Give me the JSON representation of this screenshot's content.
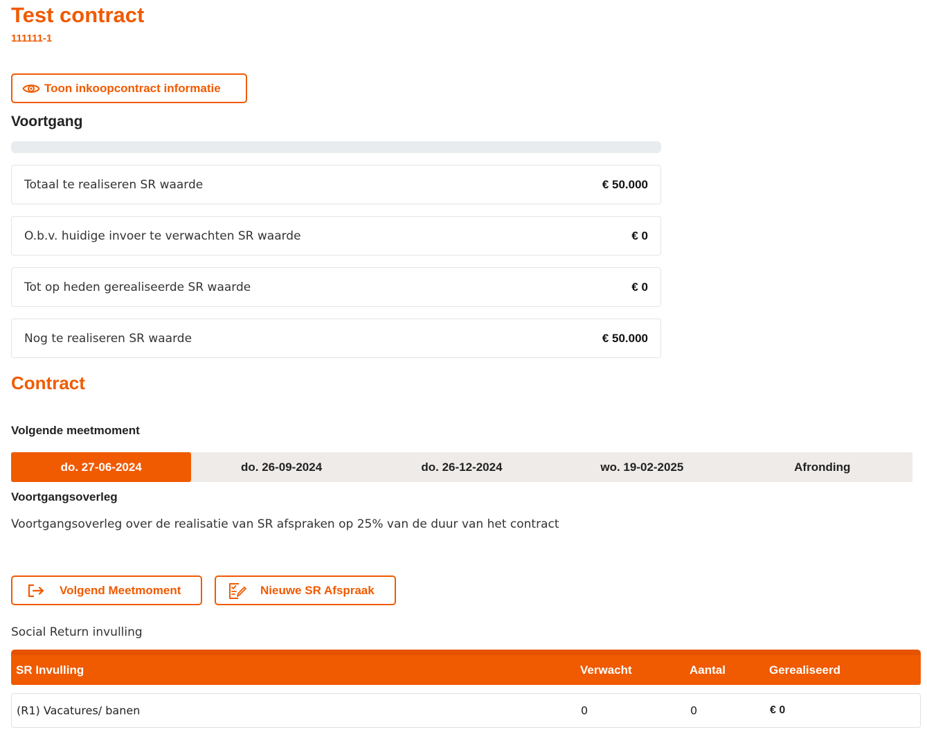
{
  "header": {
    "title": "Test contract",
    "contract_number": "111111-1"
  },
  "info_button": {
    "label": "Toon inkoopcontract informatie",
    "icon": "eye-icon"
  },
  "progress": {
    "heading": "Voortgang",
    "fraction": 0,
    "rows": [
      {
        "label": "Totaal te realiseren SR waarde",
        "value": "€ 50.000"
      },
      {
        "label": "O.b.v. huidige invoer te verwachten SR waarde",
        "value": "€ 0"
      },
      {
        "label": "Tot op heden gerealiseerde SR waarde",
        "value": "€ 0"
      },
      {
        "label": "Nog te realiseren SR waarde",
        "value": "€ 50.000"
      }
    ]
  },
  "contract": {
    "heading": "Contract",
    "next_moment_label": "Volgende meetmoment",
    "moments": [
      {
        "label": "do. 27-06-2024",
        "active": true
      },
      {
        "label": "do. 26-09-2024",
        "active": false
      },
      {
        "label": "do. 26-12-2024",
        "active": false
      },
      {
        "label": "wo. 19-02-2025",
        "active": false
      },
      {
        "label": "Afronding",
        "active": false
      }
    ],
    "moment_title": "Voortgangsoverleg",
    "moment_description": "Voortgangsoverleg over de realisatie van SR afspraken op 25% van de duur van het contract"
  },
  "actions": {
    "next_moment": {
      "label": "Volgend Meetmoment",
      "icon": "exit-arrow-icon"
    },
    "new_agreement": {
      "label": "Nieuwe SR Afspraak",
      "icon": "edit-document-icon"
    }
  },
  "sr_table": {
    "caption": "Social Return invulling",
    "headers": [
      "SR Invulling",
      "Verwacht",
      "Aantal",
      "Gerealiseerd"
    ],
    "rows": [
      [
        "(R1) Vacatures/ banen",
        "0",
        "0",
        "€ 0"
      ]
    ]
  },
  "colors": {
    "accent": "#f05a00",
    "tab_background": "#efebe8",
    "progress_track": "#e9ecef"
  }
}
